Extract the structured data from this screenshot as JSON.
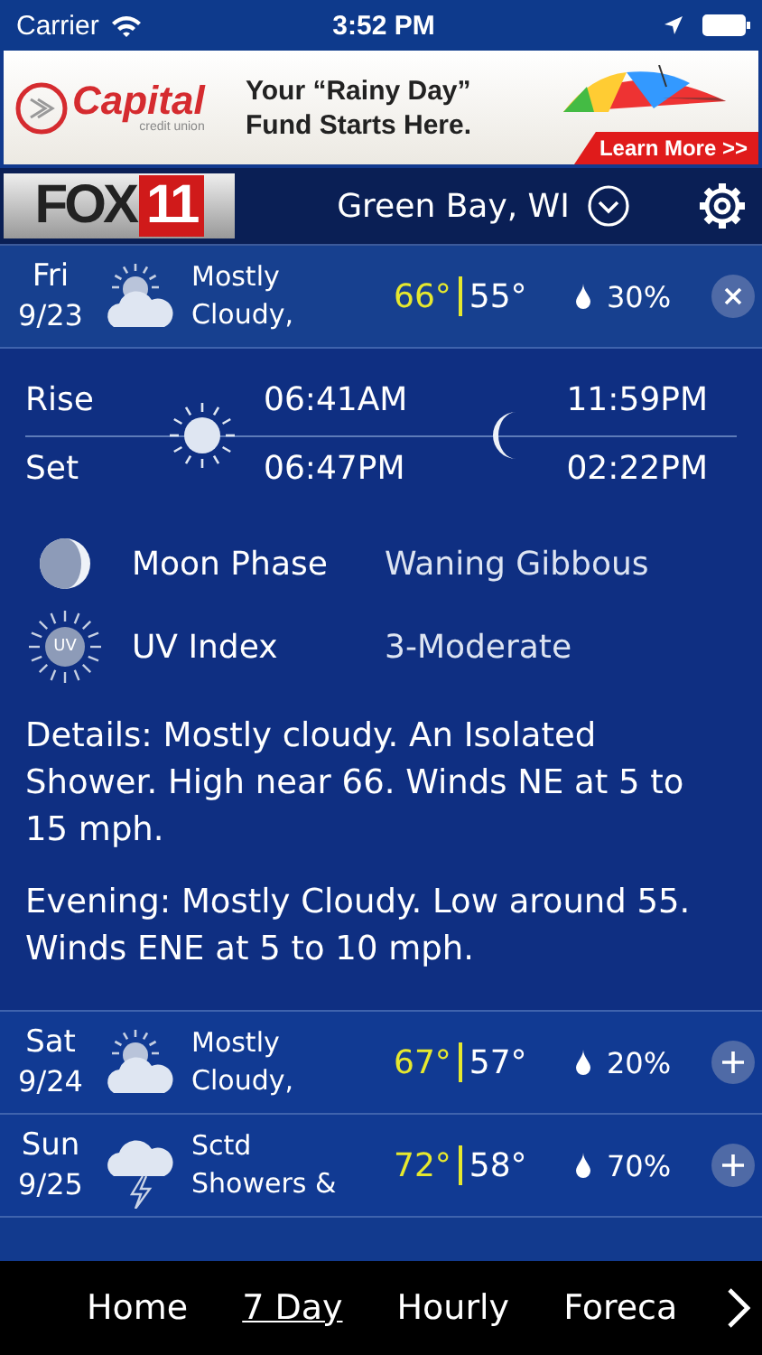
{
  "status_bar": {
    "carrier": "Carrier",
    "time": "3:52 PM"
  },
  "ad": {
    "brand": "Capital",
    "tagline": "credit union",
    "headline": "Your “Rainy Day” Fund Starts Here.",
    "cta": "Learn More >>"
  },
  "header": {
    "logo_word": "FOX",
    "logo_number": "11",
    "location": "Green Bay, WI"
  },
  "days": [
    {
      "day": "Fri",
      "date": "9/23",
      "kind": "partly-cloudy",
      "summary": "Mostly Cloudy,",
      "high": "66°",
      "low": "55°",
      "precip": "30%",
      "expanded": true
    },
    {
      "day": "Sat",
      "date": "9/24",
      "kind": "partly-cloudy",
      "summary": "Mostly Cloudy,",
      "high": "67°",
      "low": "57°",
      "precip": "20%",
      "expanded": false
    },
    {
      "day": "Sun",
      "date": "9/25",
      "kind": "thunder",
      "summary": "Sctd Showers &",
      "high": "72°",
      "low": "58°",
      "precip": "70%",
      "expanded": false
    }
  ],
  "detail": {
    "rise_label": "Rise",
    "set_label": "Set",
    "sunrise": "06:41AM",
    "sunset": "06:47PM",
    "moonrise": "11:59PM",
    "moonset": "02:22PM",
    "moon_phase_label": "Moon Phase",
    "moon_phase": "Waning Gibbous",
    "uv_label": "UV Index",
    "uv_badge": "UV",
    "uv_value": "3-Moderate",
    "paragraphs": [
      "Details: Mostly cloudy. An Isolated Shower. High near 66. Winds NE at 5 to 15 mph.",
      "Evening: Mostly Cloudy. Low around 55. Winds ENE at 5 to 10 mph."
    ]
  },
  "tabs": [
    {
      "label": "Home",
      "selected": false
    },
    {
      "label": "7 Day",
      "selected": true
    },
    {
      "label": "Hourly",
      "selected": false
    },
    {
      "label": "Foreca",
      "selected": false
    }
  ]
}
